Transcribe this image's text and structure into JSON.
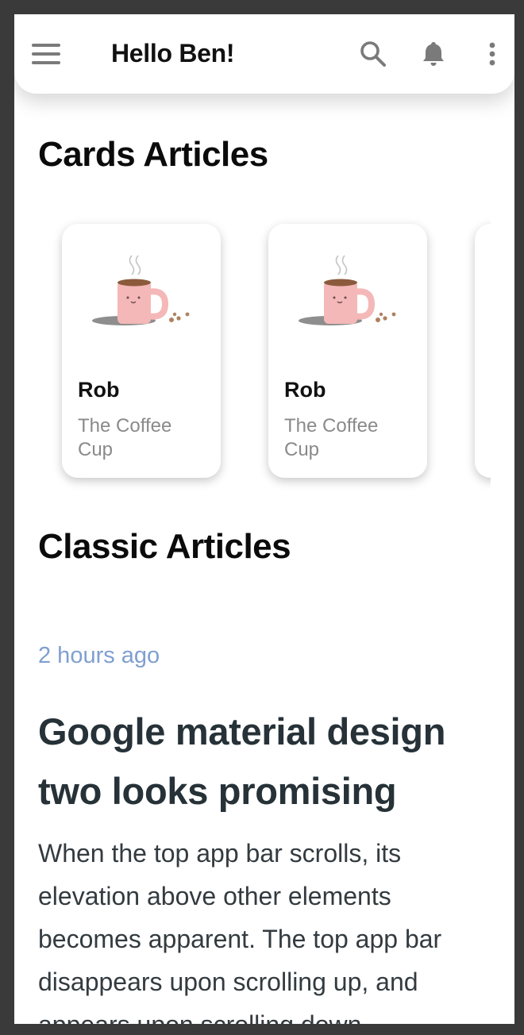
{
  "appbar": {
    "title": "Hello Ben!",
    "icons": [
      "menu-icon",
      "search-icon",
      "bell-icon",
      "more-vert-icon"
    ]
  },
  "cards_section": {
    "title": "Cards Articles",
    "cards": [
      {
        "name": "Rob",
        "subtitle": "The Coffee Cup",
        "image": "coffee-mug-illustration"
      },
      {
        "name": "Rob",
        "subtitle": "The Coffee Cup",
        "image": "coffee-mug-illustration"
      }
    ]
  },
  "classic_section": {
    "title": "Classic Articles",
    "article": {
      "time": "2 hours ago",
      "headline": "Google material design two looks promising",
      "body": "When the top app bar scrolls, its elevation above other elements becomes apparent. The top app bar disappears upon scrolling up, and appears upon scrolling down."
    }
  },
  "colors": {
    "background_frame": "#3a3a3a",
    "surface": "#ffffff",
    "time_text": "#7f9fcf",
    "headline_text": "#263238",
    "icon_gray": "#7a7a7a",
    "mug_pink": "#f4b8b8"
  }
}
